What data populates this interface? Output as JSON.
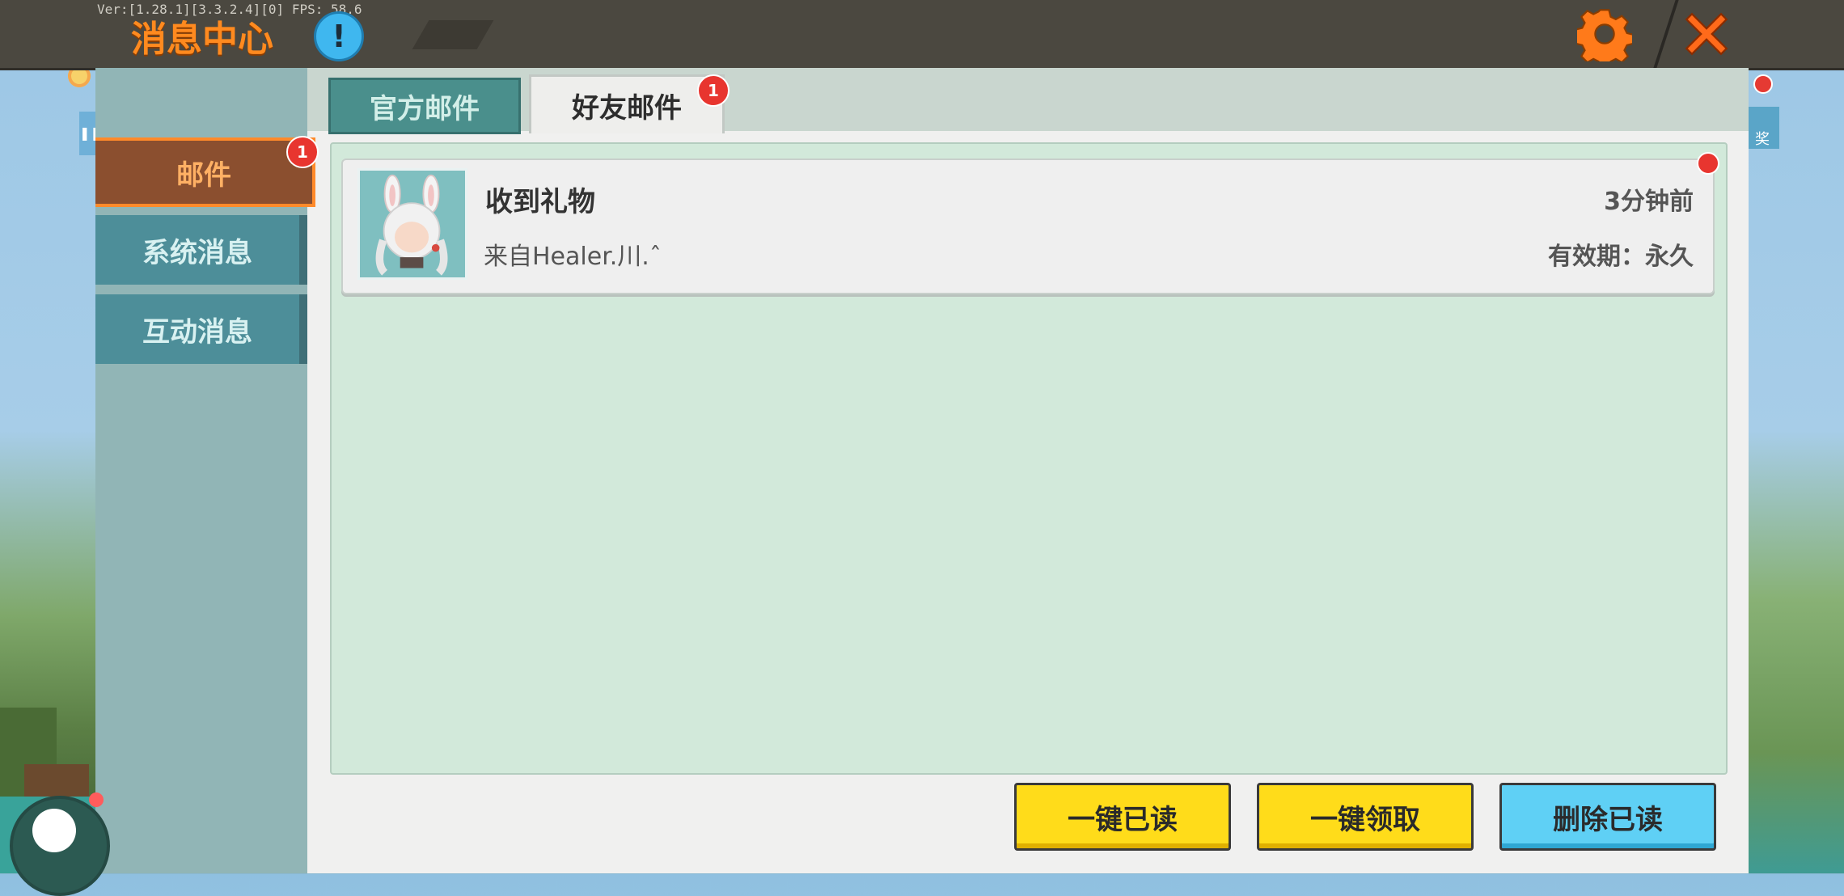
{
  "header": {
    "version_text": "Ver:[1.28.1][3.3.2.4][0] FPS: 58.6",
    "title": "消息中心",
    "info_icon": "!"
  },
  "side_menu": {
    "items": [
      {
        "label": "邮件",
        "active": true,
        "badge": "1"
      },
      {
        "label": "系统消息",
        "active": false
      },
      {
        "label": "互动消息",
        "active": false
      }
    ]
  },
  "tabs": [
    {
      "label": "官方邮件",
      "active": false
    },
    {
      "label": "好友邮件",
      "active": true,
      "badge": "1"
    }
  ],
  "mails": [
    {
      "title": "收到礼物",
      "from": "来自Healer.川.ˆ",
      "time": "3分钟前",
      "expiry": "有效期：永久",
      "unread": true
    }
  ],
  "actions": {
    "read_all": "一键已读",
    "claim_all": "一键领取",
    "delete_read": "删除已读"
  },
  "background": {
    "right_tag_text": "奖"
  },
  "colors": {
    "title_orange": "#ff8a1f",
    "active_side": "#8b4f2f",
    "list_bg": "#d2e9da",
    "yellow_button": "#ffdc1a",
    "blue_button": "#5fd0f5",
    "badge_red": "#e8352f"
  }
}
